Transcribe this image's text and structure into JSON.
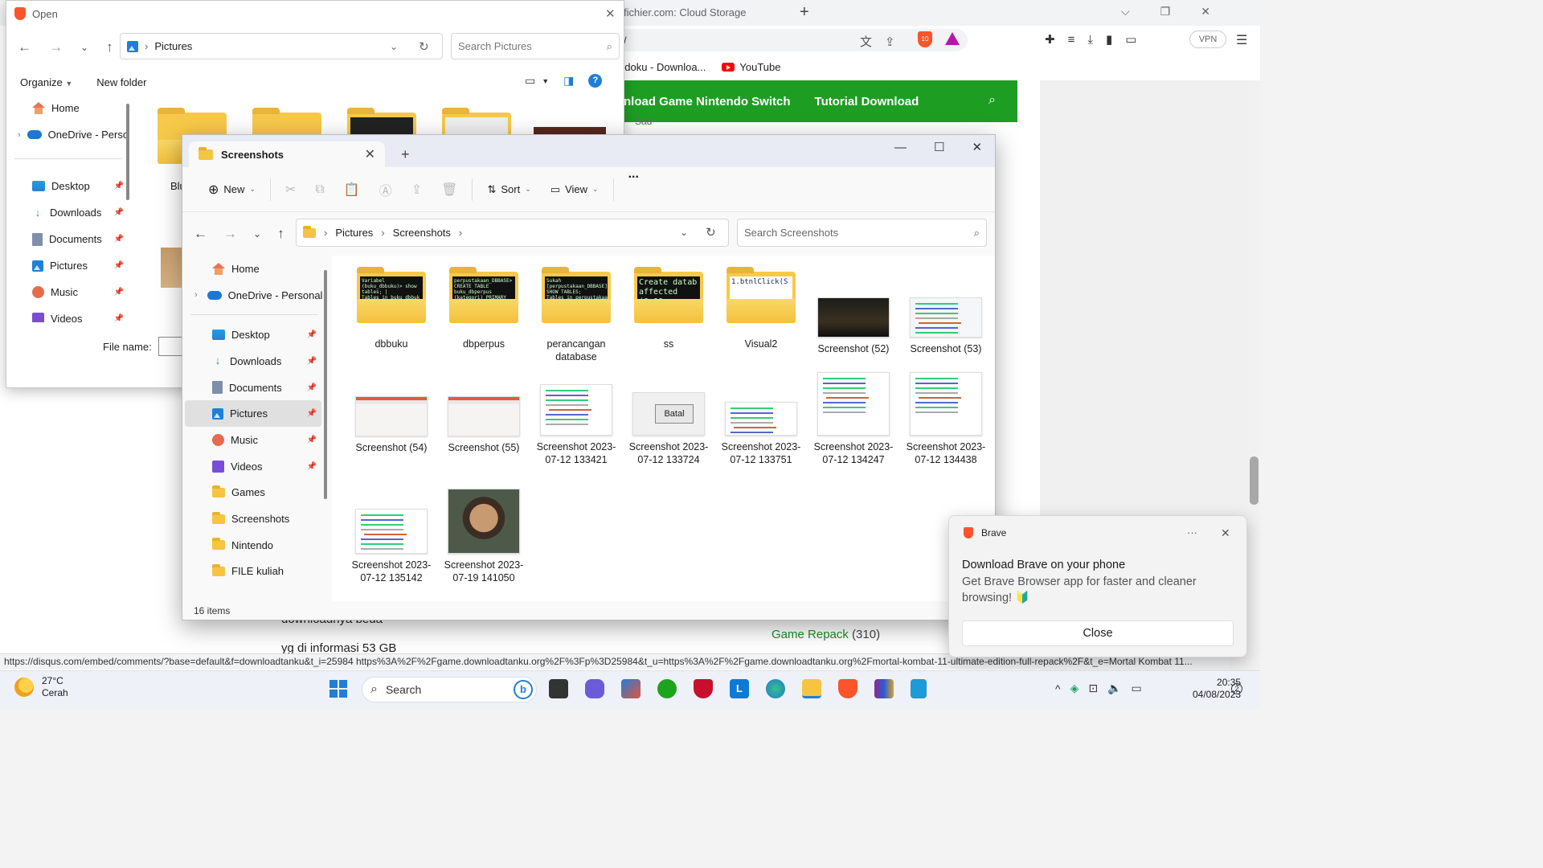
{
  "browser": {
    "tab_title": "fichier.com: Cloud Storage",
    "address_partial": "/",
    "shield_count": "10",
    "vpn_label": "VPN",
    "bookmarks": [
      "ndoku - Downloa...",
      "YouTube"
    ],
    "site_nav": [
      "nload Game Nintendo Switch",
      "Tutorial Download"
    ],
    "said_text": "Sad",
    "content_line1": "downloadnya beda",
    "content_line2": "yg di informasi 53 GB",
    "game_repack_label": "Game Repack",
    "game_repack_count": "(310)",
    "status_url": "https://disqus.com/embed/comments/?base=default&f=downloadtanku&t_i=25984 https%3A%2F%2Fgame.downloadtanku.org%2F%3Fp%3D25984&t_u=https%3A%2F%2Fgame.downloadtanku.org%2Fmortal-kombat-11-ultimate-edition-full-repack%2F&t_e=Mortal Kombat 11...",
    "accent_green": "#1d9e23"
  },
  "open_dialog": {
    "title": "Open",
    "path_label": "Pictures",
    "search_placeholder": "Search Pictures",
    "organize_label": "Organize",
    "new_folder_label": "New folder",
    "help_label": "?",
    "file_name_label": "File name:",
    "file_name_value": "",
    "sidebar": [
      {
        "label": "Home",
        "icon": "home-icon",
        "pinned": false
      },
      {
        "label": "OneDrive - Perso",
        "icon": "cloud-icon",
        "pinned": false
      },
      {
        "label": "Desktop",
        "icon": "desktop-icon",
        "pinned": true
      },
      {
        "label": "Downloads",
        "icon": "downloads-icon",
        "pinned": true
      },
      {
        "label": "Documents",
        "icon": "documents-icon",
        "pinned": true
      },
      {
        "label": "Pictures",
        "icon": "pictures-icon",
        "pinned": true
      },
      {
        "label": "Music",
        "icon": "music-icon",
        "pinned": true
      },
      {
        "label": "Videos",
        "icon": "videos-icon",
        "pinned": true
      }
    ],
    "partial_item": "Blu"
  },
  "explorer": {
    "tab_title": "Screenshots",
    "toolbar": {
      "new_label": "New",
      "sort_label": "Sort",
      "view_label": "View",
      "more_label": "..."
    },
    "breadcrumb": [
      "Pictures",
      "Screenshots"
    ],
    "search_placeholder": "Search Screenshots",
    "sidebar": [
      {
        "label": "Home",
        "icon": "home-icon",
        "pinned": false
      },
      {
        "label": "OneDrive - Personal",
        "icon": "cloud-icon",
        "pinned": false
      },
      {
        "label": "Desktop",
        "icon": "desktop-icon",
        "pinned": true
      },
      {
        "label": "Downloads",
        "icon": "downloads-icon",
        "pinned": true
      },
      {
        "label": "Documents",
        "icon": "documents-icon",
        "pinned": true
      },
      {
        "label": "Pictures",
        "icon": "pictures-icon",
        "pinned": true,
        "selected": true
      },
      {
        "label": "Music",
        "icon": "music-icon",
        "pinned": true
      },
      {
        "label": "Videos",
        "icon": "videos-icon",
        "pinned": true
      },
      {
        "label": "Games",
        "icon": "folder-icon",
        "pinned": false
      },
      {
        "label": "Screenshots",
        "icon": "folder-icon",
        "pinned": false
      },
      {
        "label": "Nintendo",
        "icon": "folder-icon",
        "pinned": false
      },
      {
        "label": "FILE kuliah",
        "icon": "folder-icon",
        "pinned": false
      }
    ],
    "items": [
      {
        "name": "dbbuku",
        "kind": "folder",
        "preview": "Variabel (buku_dbbuku)> show tables; | Tables_in_buku_dbbuk | buku | katogori |"
      },
      {
        "name": "dbperpus",
        "kind": "folder",
        "preview": "perpustakaan_DBBASE> CREATE TABLE buku_dbperpus (kategori) PRIMARY KEY AUTO_INCREMENT"
      },
      {
        "name": "perancangan database",
        "kind": "folder",
        "preview": "Sukah [perpustakaan_DBBASE]> SHOW TABLES; Tables_in_perpustakaan_DBBA | anggota |"
      },
      {
        "name": "ss",
        "kind": "folder",
        "preview": "Create datab affected (0.00"
      },
      {
        "name": "Visual2",
        "kind": "folder",
        "preview": "1.btnlClick(S"
      },
      {
        "name": "Screenshot (52)",
        "kind": "image-dark"
      },
      {
        "name": "Screenshot (53)",
        "kind": "image-code"
      },
      {
        "name": "Screenshot (54)",
        "kind": "image-web"
      },
      {
        "name": "Screenshot (55)",
        "kind": "image-web"
      },
      {
        "name": "Screenshot 2023-07-12 133421",
        "kind": "image-code"
      },
      {
        "name": "Screenshot 2023-07-12 133724",
        "kind": "image-button",
        "button_text": "Batal"
      },
      {
        "name": "Screenshot 2023-07-12 133751",
        "kind": "image-code"
      },
      {
        "name": "Screenshot 2023-07-12 134247",
        "kind": "image-code"
      },
      {
        "name": "Screenshot 2023-07-12 134438",
        "kind": "image-code"
      },
      {
        "name": "Screenshot 2023-07-12 135142",
        "kind": "image-code"
      },
      {
        "name": "Screenshot 2023-07-19 141050",
        "kind": "image-face"
      }
    ],
    "status": "16 items"
  },
  "toast": {
    "app": "Brave",
    "more": "···",
    "title": "Download Brave on your phone",
    "body": "Get Brave Browser app for faster and cleaner browsing! 🔰",
    "close_label": "Close"
  },
  "taskbar": {
    "temperature": "27°C",
    "weather": "Cerah",
    "search_label": "Search",
    "time": "20:35",
    "date": "04/08/2023",
    "notif_count": "2"
  }
}
